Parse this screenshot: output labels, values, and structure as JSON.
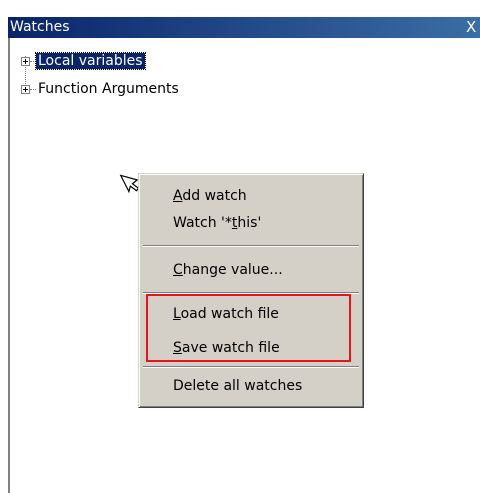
{
  "panel": {
    "title": "Watches",
    "close_glyph": "X"
  },
  "tree": {
    "items": [
      {
        "label": "Local variables",
        "selected": true
      },
      {
        "label": "Function Arguments",
        "selected": false
      }
    ]
  },
  "context_menu": {
    "items": [
      {
        "pre": "",
        "accel": "A",
        "post": "dd watch"
      },
      {
        "pre": "Watch '*",
        "accel": "t",
        "post": "his'"
      },
      {
        "pre": "",
        "accel": "C",
        "post": "hange value..."
      },
      {
        "pre": "",
        "accel": "L",
        "post": "oad watch file"
      },
      {
        "pre": "",
        "accel": "S",
        "post": "ave watch file"
      },
      {
        "pre": "Delete all watches",
        "accel": "",
        "post": ""
      }
    ]
  },
  "colors": {
    "title_gradient_start": "#0a246a",
    "title_gradient_end": "#3a6ea5",
    "menu_background": "#d4d0c8",
    "highlight_box": "#e8141b"
  },
  "icons": {
    "cursor": "arrow-cursor-icon",
    "expander": "plus-box-icon"
  }
}
